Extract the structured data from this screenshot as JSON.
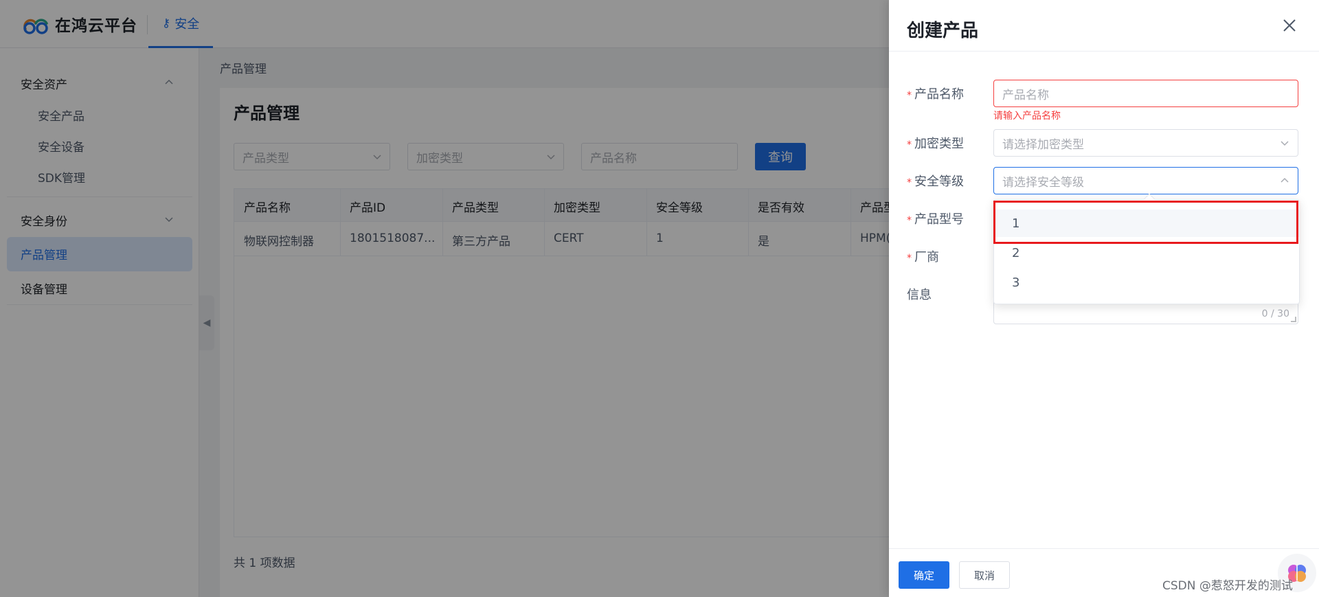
{
  "header": {
    "logo_text": "在鸿云平台",
    "tab_label": "安全",
    "tab_icon": "key-icon"
  },
  "sidebar": {
    "group1": {
      "label": "安全资产",
      "items": [
        "安全产品",
        "安全设备",
        "SDK管理"
      ]
    },
    "group2": {
      "label": "安全身份"
    },
    "active_item": "产品管理",
    "item_device": "设备管理"
  },
  "main": {
    "breadcrumb": "产品管理",
    "title": "产品管理",
    "filters": {
      "product_type": "产品类型",
      "encrypt_type": "加密类型",
      "product_name": "产品名称"
    },
    "query_label": "查询",
    "table": {
      "headers": [
        "产品名称",
        "产品ID",
        "产品类型",
        "加密类型",
        "安全等级",
        "是否有效",
        "产品型"
      ],
      "rows": [
        [
          "物联网控制器",
          "1801518087...",
          "第三方产品",
          "CERT",
          "1",
          "是",
          "HPM("
        ]
      ]
    },
    "total": "共 1 项数据"
  },
  "drawer": {
    "title": "创建产品",
    "fields": {
      "product_name_label": "产品名称",
      "product_name_placeholder": "产品名称",
      "product_name_error": "请输入产品名称",
      "encrypt_label": "加密类型",
      "encrypt_placeholder": "请选择加密类型",
      "security_label": "安全等级",
      "security_placeholder": "请选择安全等级",
      "model_label": "产品型号",
      "vendor_label": "厂商",
      "info_label": "信息",
      "info_counter": "0 / 30"
    },
    "security_options": [
      "1",
      "2",
      "3"
    ],
    "ok_label": "确定",
    "cancel_label": "取消"
  },
  "watermark": "CSDN @惹怒开发的测试",
  "colors": {
    "primary": "#1f6fe5",
    "error": "#f53f3f",
    "highlight": "#e8191d"
  }
}
